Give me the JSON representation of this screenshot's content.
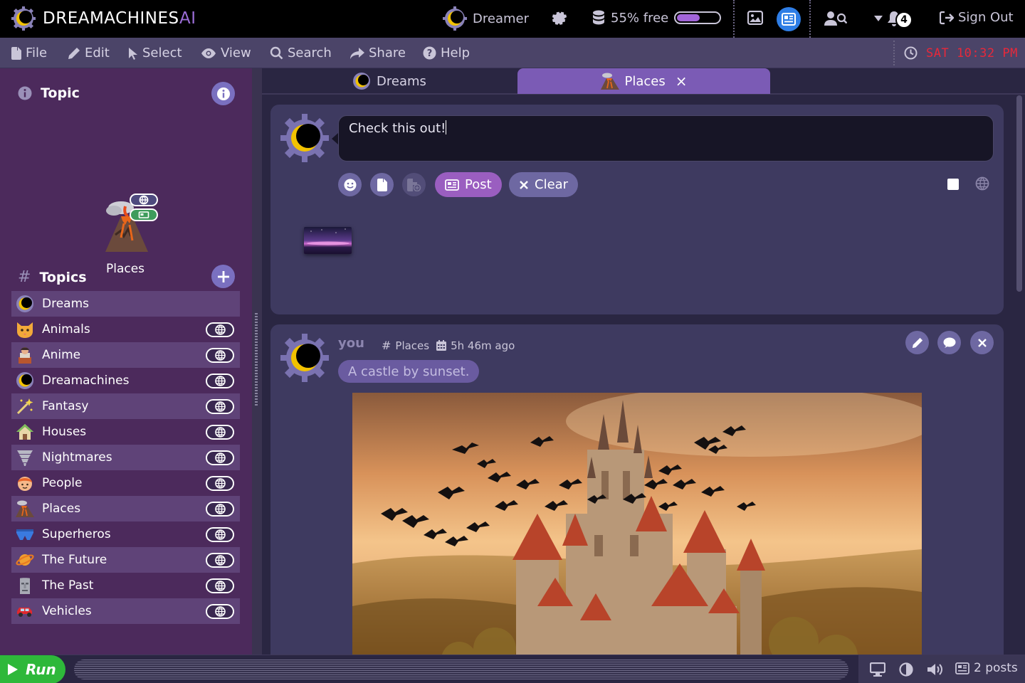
{
  "app": {
    "brand_main": "DREAMACHINES",
    "brand_ai": "AI",
    "user_name": "Dreamer",
    "storage_label": "55% free",
    "storage_free_fraction": 0.55,
    "notification_count": "4",
    "sign_out_label": "Sign Out",
    "colors": {
      "accent": "#7b5bb5",
      "sidebar": "#4c2a5c",
      "clock": "#e8283a",
      "run": "#2eb83a",
      "feed_active": "#2f7ee6"
    }
  },
  "menu": {
    "items": [
      "File",
      "Edit",
      "Select",
      "View",
      "Search",
      "Share",
      "Help"
    ],
    "icons": [
      "file-icon",
      "pencil-icon",
      "cursor-icon",
      "eye-icon",
      "magnifier-icon",
      "share-icon",
      "question-icon"
    ],
    "clock": "SAT 10:32 PM"
  },
  "sidebar": {
    "topic_heading": "Topic",
    "current_topic": "Places",
    "topics_heading": "Topics",
    "topics": [
      {
        "label": "Dreams",
        "icon": "eclipse-icon",
        "public": false
      },
      {
        "label": "Animals",
        "icon": "cat-icon",
        "public": true
      },
      {
        "label": "Anime",
        "icon": "figure-icon",
        "public": true
      },
      {
        "label": "Dreamachines",
        "icon": "eclipse-icon",
        "public": true
      },
      {
        "label": "Fantasy",
        "icon": "magic-wand-icon",
        "public": true
      },
      {
        "label": "Houses",
        "icon": "house-icon",
        "public": true
      },
      {
        "label": "Nightmares",
        "icon": "tornado-icon",
        "public": true
      },
      {
        "label": "People",
        "icon": "face-icon",
        "public": true
      },
      {
        "label": "Places",
        "icon": "volcano-icon",
        "public": true
      },
      {
        "label": "Superheros",
        "icon": "briefs-icon",
        "public": true
      },
      {
        "label": "The Future",
        "icon": "planet-icon",
        "public": true
      },
      {
        "label": "The Past",
        "icon": "moai-icon",
        "public": true
      },
      {
        "label": "Vehicles",
        "icon": "car-icon",
        "public": true
      }
    ]
  },
  "tabs": [
    {
      "label": "Dreams",
      "icon": "eclipse-icon",
      "active": false
    },
    {
      "label": "Places",
      "icon": "volcano-icon",
      "active": true,
      "close": "×"
    }
  ],
  "composer": {
    "text": "Check this out!",
    "post_label": "Post",
    "clear_label": "Clear"
  },
  "post": {
    "author": "you",
    "topic": "Places",
    "time": "5h 46m ago",
    "caption": "A castle by sunset."
  },
  "footer": {
    "run_label": "Run",
    "posts_count": "2 posts"
  }
}
